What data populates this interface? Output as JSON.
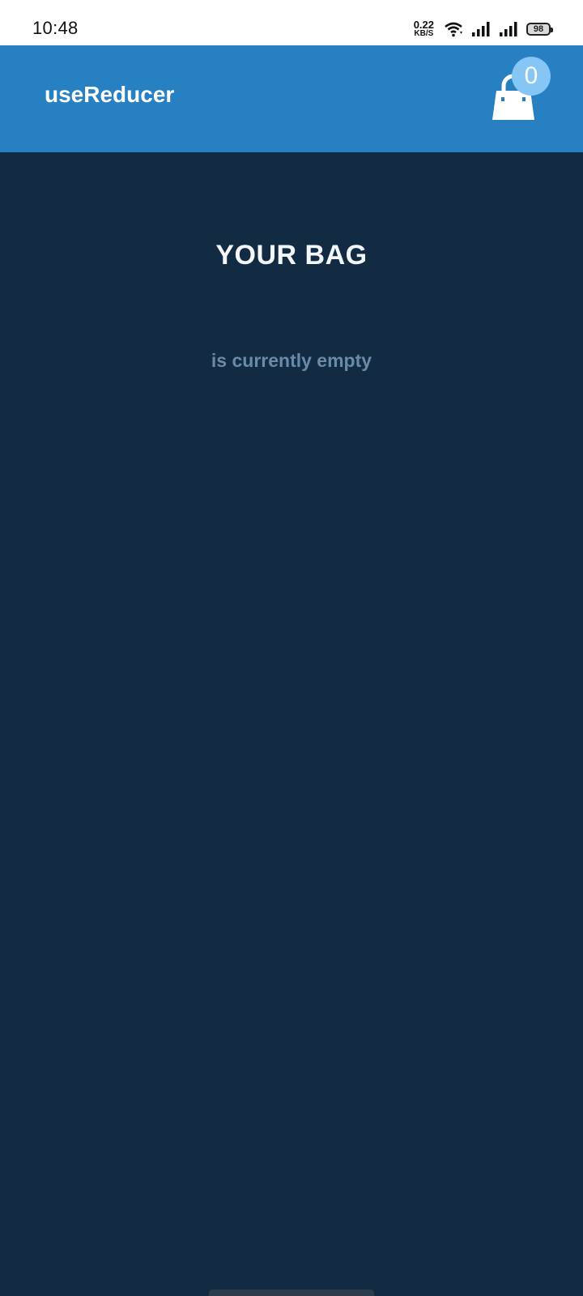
{
  "status_bar": {
    "time": "10:48",
    "net_speed_value": "0.22",
    "net_speed_unit": "KB/S",
    "battery": "98",
    "icons": [
      "wifi-icon",
      "signal-icon",
      "signal-icon",
      "battery-icon"
    ]
  },
  "app_bar": {
    "title": "useReducer",
    "bag_count": "0",
    "bag_icon": "shopping-bag-icon",
    "background_color": "#2680c2",
    "badge_color": "#85c6f5"
  },
  "main": {
    "heading": "YOUR BAG",
    "empty_message": "is currently empty",
    "background_color": "#122a42"
  }
}
